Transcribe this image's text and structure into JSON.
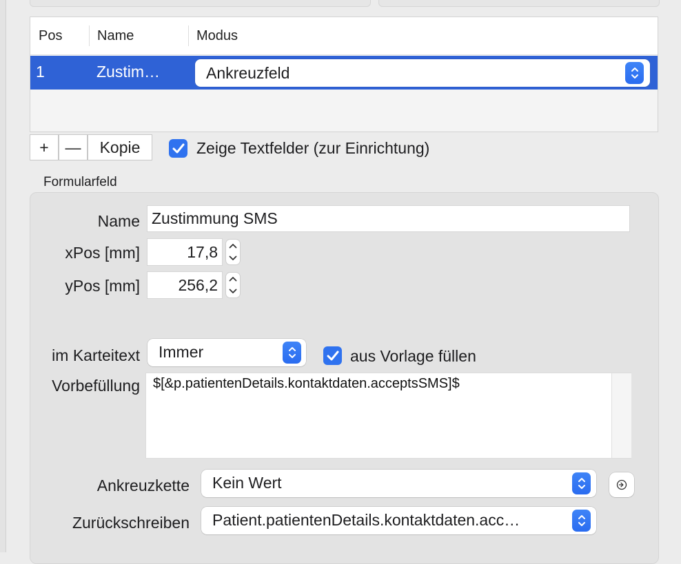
{
  "table": {
    "columns": [
      "Pos",
      "Name",
      "Modus"
    ],
    "rows": [
      {
        "pos": "1",
        "name": "Zustim…",
        "mode": "Ankreuzfeld"
      }
    ]
  },
  "toolbar": {
    "add_label": "+",
    "remove_label": "—",
    "copy_label": "Kopie",
    "show_textfields_label": "Zeige Textfelder (zur Einrichtung)",
    "show_textfields_checked": true
  },
  "form": {
    "section_title": "Formularfeld",
    "name_label": "Name",
    "name_value": "Zustimmung SMS",
    "xpos_label": "xPos [mm]",
    "xpos_value": "17,8",
    "ypos_label": "yPos [mm]",
    "ypos_value": "256,2",
    "karteitext_label": "im Karteitext",
    "karteitext_value": "Immer",
    "from_template_label": "aus Vorlage füllen",
    "from_template_checked": true,
    "prefill_label": "Vorbefüllung",
    "prefill_value": "$[&p.patientenDetails.kontaktdaten.acceptsSMS]$",
    "chain_label": "Ankreuzkette",
    "chain_value": "Kein Wert",
    "writeback_label": "Zurückschreiben",
    "writeback_value": "Patient.patientenDetails.kontaktdaten.acc…"
  },
  "colors": {
    "selection": "#2f62d6",
    "accent": "#2f72ef"
  }
}
